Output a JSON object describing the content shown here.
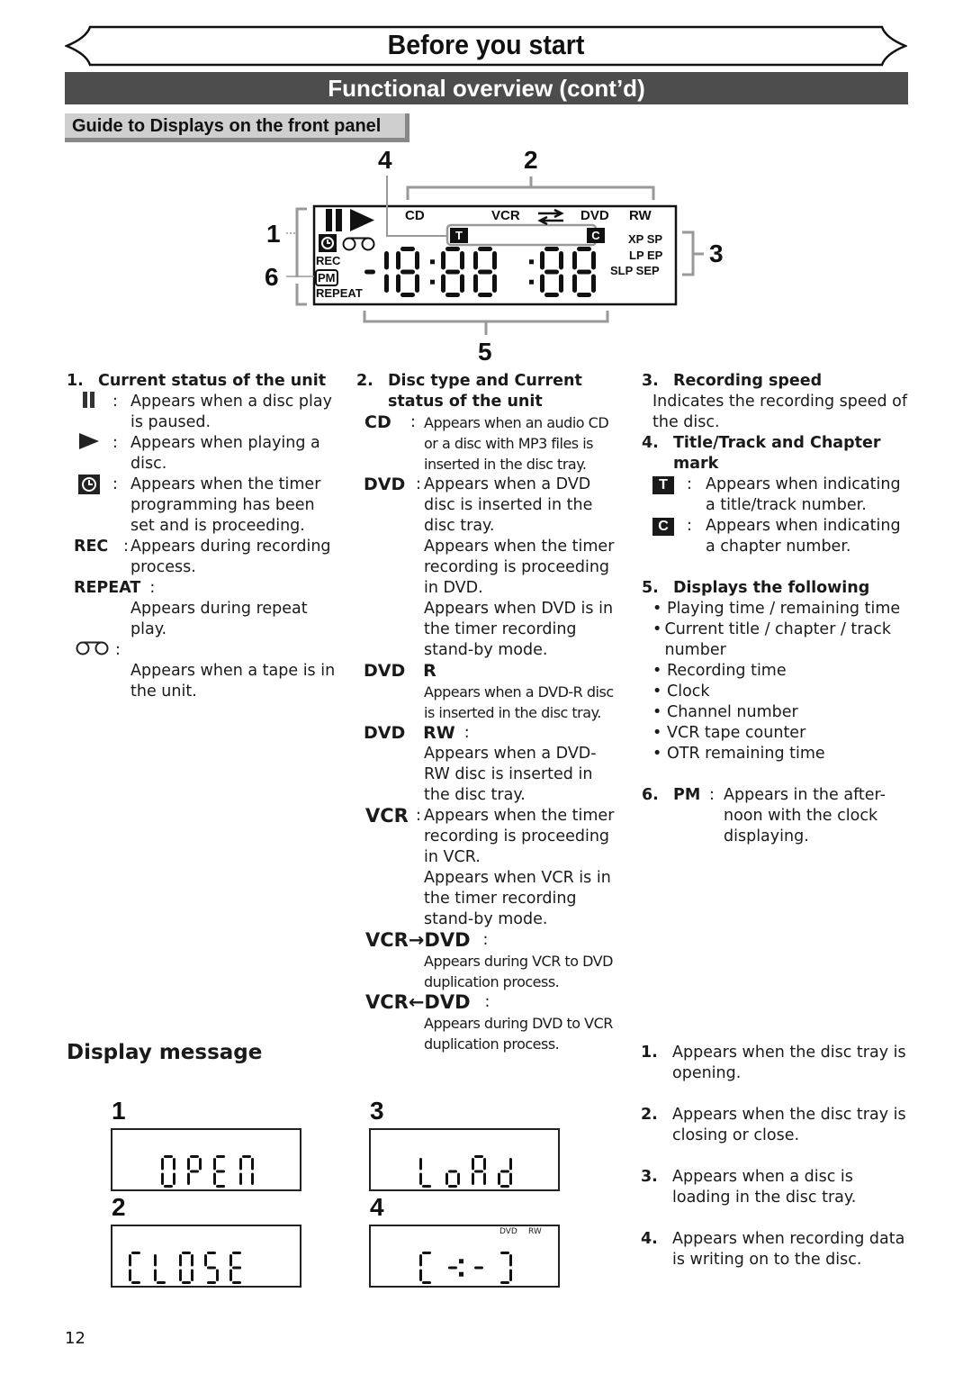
{
  "header": {
    "banner_title": "Before you start",
    "section_title": "Functional overview (cont’d)",
    "subsection_title": "Guide to Displays on the front panel"
  },
  "front_panel": {
    "callouts": [
      "1",
      "2",
      "3",
      "4",
      "5",
      "6"
    ],
    "labels": {
      "cd": "CD",
      "vcr": "VCR",
      "dvd": "DVD",
      "rw": "RW",
      "rec": "REC",
      "pm": "PM",
      "repeat": "REPEAT",
      "title_mark": "T",
      "chapter_mark": "C",
      "speed_row1": "XP SP",
      "speed_row2": "LP EP",
      "speed_row3": "SLP SEP"
    },
    "digits": "-18:88:88",
    "icons": [
      "pause-icon",
      "play-icon",
      "timer-icon",
      "tape-icon",
      "transfer-arrows-icon"
    ]
  },
  "section1": {
    "heading_num": "1.",
    "heading": "Current status of the unit",
    "items": [
      {
        "symbol": "II",
        "icon": "pause-icon",
        "sep": ":",
        "text": "Appears when a disc play is paused."
      },
      {
        "symbol": "▶",
        "icon": "play-icon",
        "sep": ":",
        "text": "Appears when playing a disc."
      },
      {
        "symbol": "timer",
        "icon": "timer-icon",
        "sep": ":",
        "text": "Appears when the timer programming has been set and is proceeding."
      },
      {
        "symbol": "REC",
        "sep": ":",
        "text": "Appears during recording process."
      },
      {
        "symbol": "REPEAT",
        "sep": ":",
        "text": "Appears during repeat play."
      },
      {
        "symbol": "tape",
        "icon": "tape-icon",
        "sep": ":",
        "text": "Appears when a tape is in the unit."
      }
    ]
  },
  "section2": {
    "heading_num": "2.",
    "heading": "Disc type and Current status of the unit",
    "items": [
      {
        "symbol": "CD",
        "sep": ":",
        "text": "Appears when an audio CD or a disc with MP3 files is inserted in the disc tray."
      },
      {
        "symbol": "DVD",
        "sep": ":",
        "text": "Appears when a DVD disc is inserted in the disc tray.",
        "text2": "Appears when the timer recording is proceeding in DVD.",
        "text3": "Appears when DVD is in the timer recording stand-by mode."
      },
      {
        "symbol": "DVD",
        "symbol2": "R",
        "sep": ":",
        "text": "Appears when a DVD-R disc is inserted in the disc tray."
      },
      {
        "symbol": "DVD",
        "symbol2": "RW",
        "sep": ":",
        "text": "Appears when a DVD-RW disc is inserted in the disc tray."
      },
      {
        "symbol": "VCR",
        "sep": ":",
        "text": "Appears when the timer recording is proceeding in VCR.",
        "text2": "Appears when VCR is in the timer recording stand-by mode."
      },
      {
        "symbol": "VCR→DVD",
        "sep": ":",
        "text": "Appears during VCR to DVD duplication process."
      },
      {
        "symbol": "VCR←DVD",
        "sep": ":",
        "text": "Appears during DVD to VCR duplication process."
      }
    ]
  },
  "section3": {
    "heading_num": "3.",
    "heading": "Recording speed",
    "text": "Indicates the recording speed of the disc."
  },
  "section4": {
    "heading_num": "4.",
    "heading": "Title/Track and Chapter mark",
    "items": [
      {
        "symbol": "T",
        "sep": ":",
        "text": "Appears when indicating a title/track number."
      },
      {
        "symbol": "C",
        "sep": ":",
        "text": "Appears when indicating a chapter number."
      }
    ]
  },
  "section5": {
    "heading_num": "5.",
    "heading": "Displays the following",
    "bullets": [
      "Playing time / remaining time",
      "Current title / chapter / track number",
      "Recording time",
      "Clock",
      "Channel number",
      "VCR tape counter",
      "OTR remaining time"
    ]
  },
  "section6": {
    "heading_num": "6.",
    "symbol": "PM",
    "sep": ":",
    "text": "Appears in the after-noon with the clock displaying."
  },
  "display_message": {
    "title": "Display message",
    "panels": [
      {
        "num": "1",
        "display": "OPEN"
      },
      {
        "num": "2",
        "display": "CLOSE"
      },
      {
        "num": "3",
        "display": "LoAd"
      },
      {
        "num": "4",
        "display": "[-:-]",
        "indicators": [
          "DVD",
          "RW"
        ]
      }
    ],
    "descriptions": [
      {
        "num": "1.",
        "text": "Appears when the disc tray is opening."
      },
      {
        "num": "2.",
        "text": "Appears when the disc tray is closing or close."
      },
      {
        "num": "3.",
        "text": "Appears when a disc is loading in the disc tray."
      },
      {
        "num": "4.",
        "text": "Appears when recording data is writing on to the disc."
      }
    ]
  },
  "footer": {
    "page_number": "12"
  }
}
